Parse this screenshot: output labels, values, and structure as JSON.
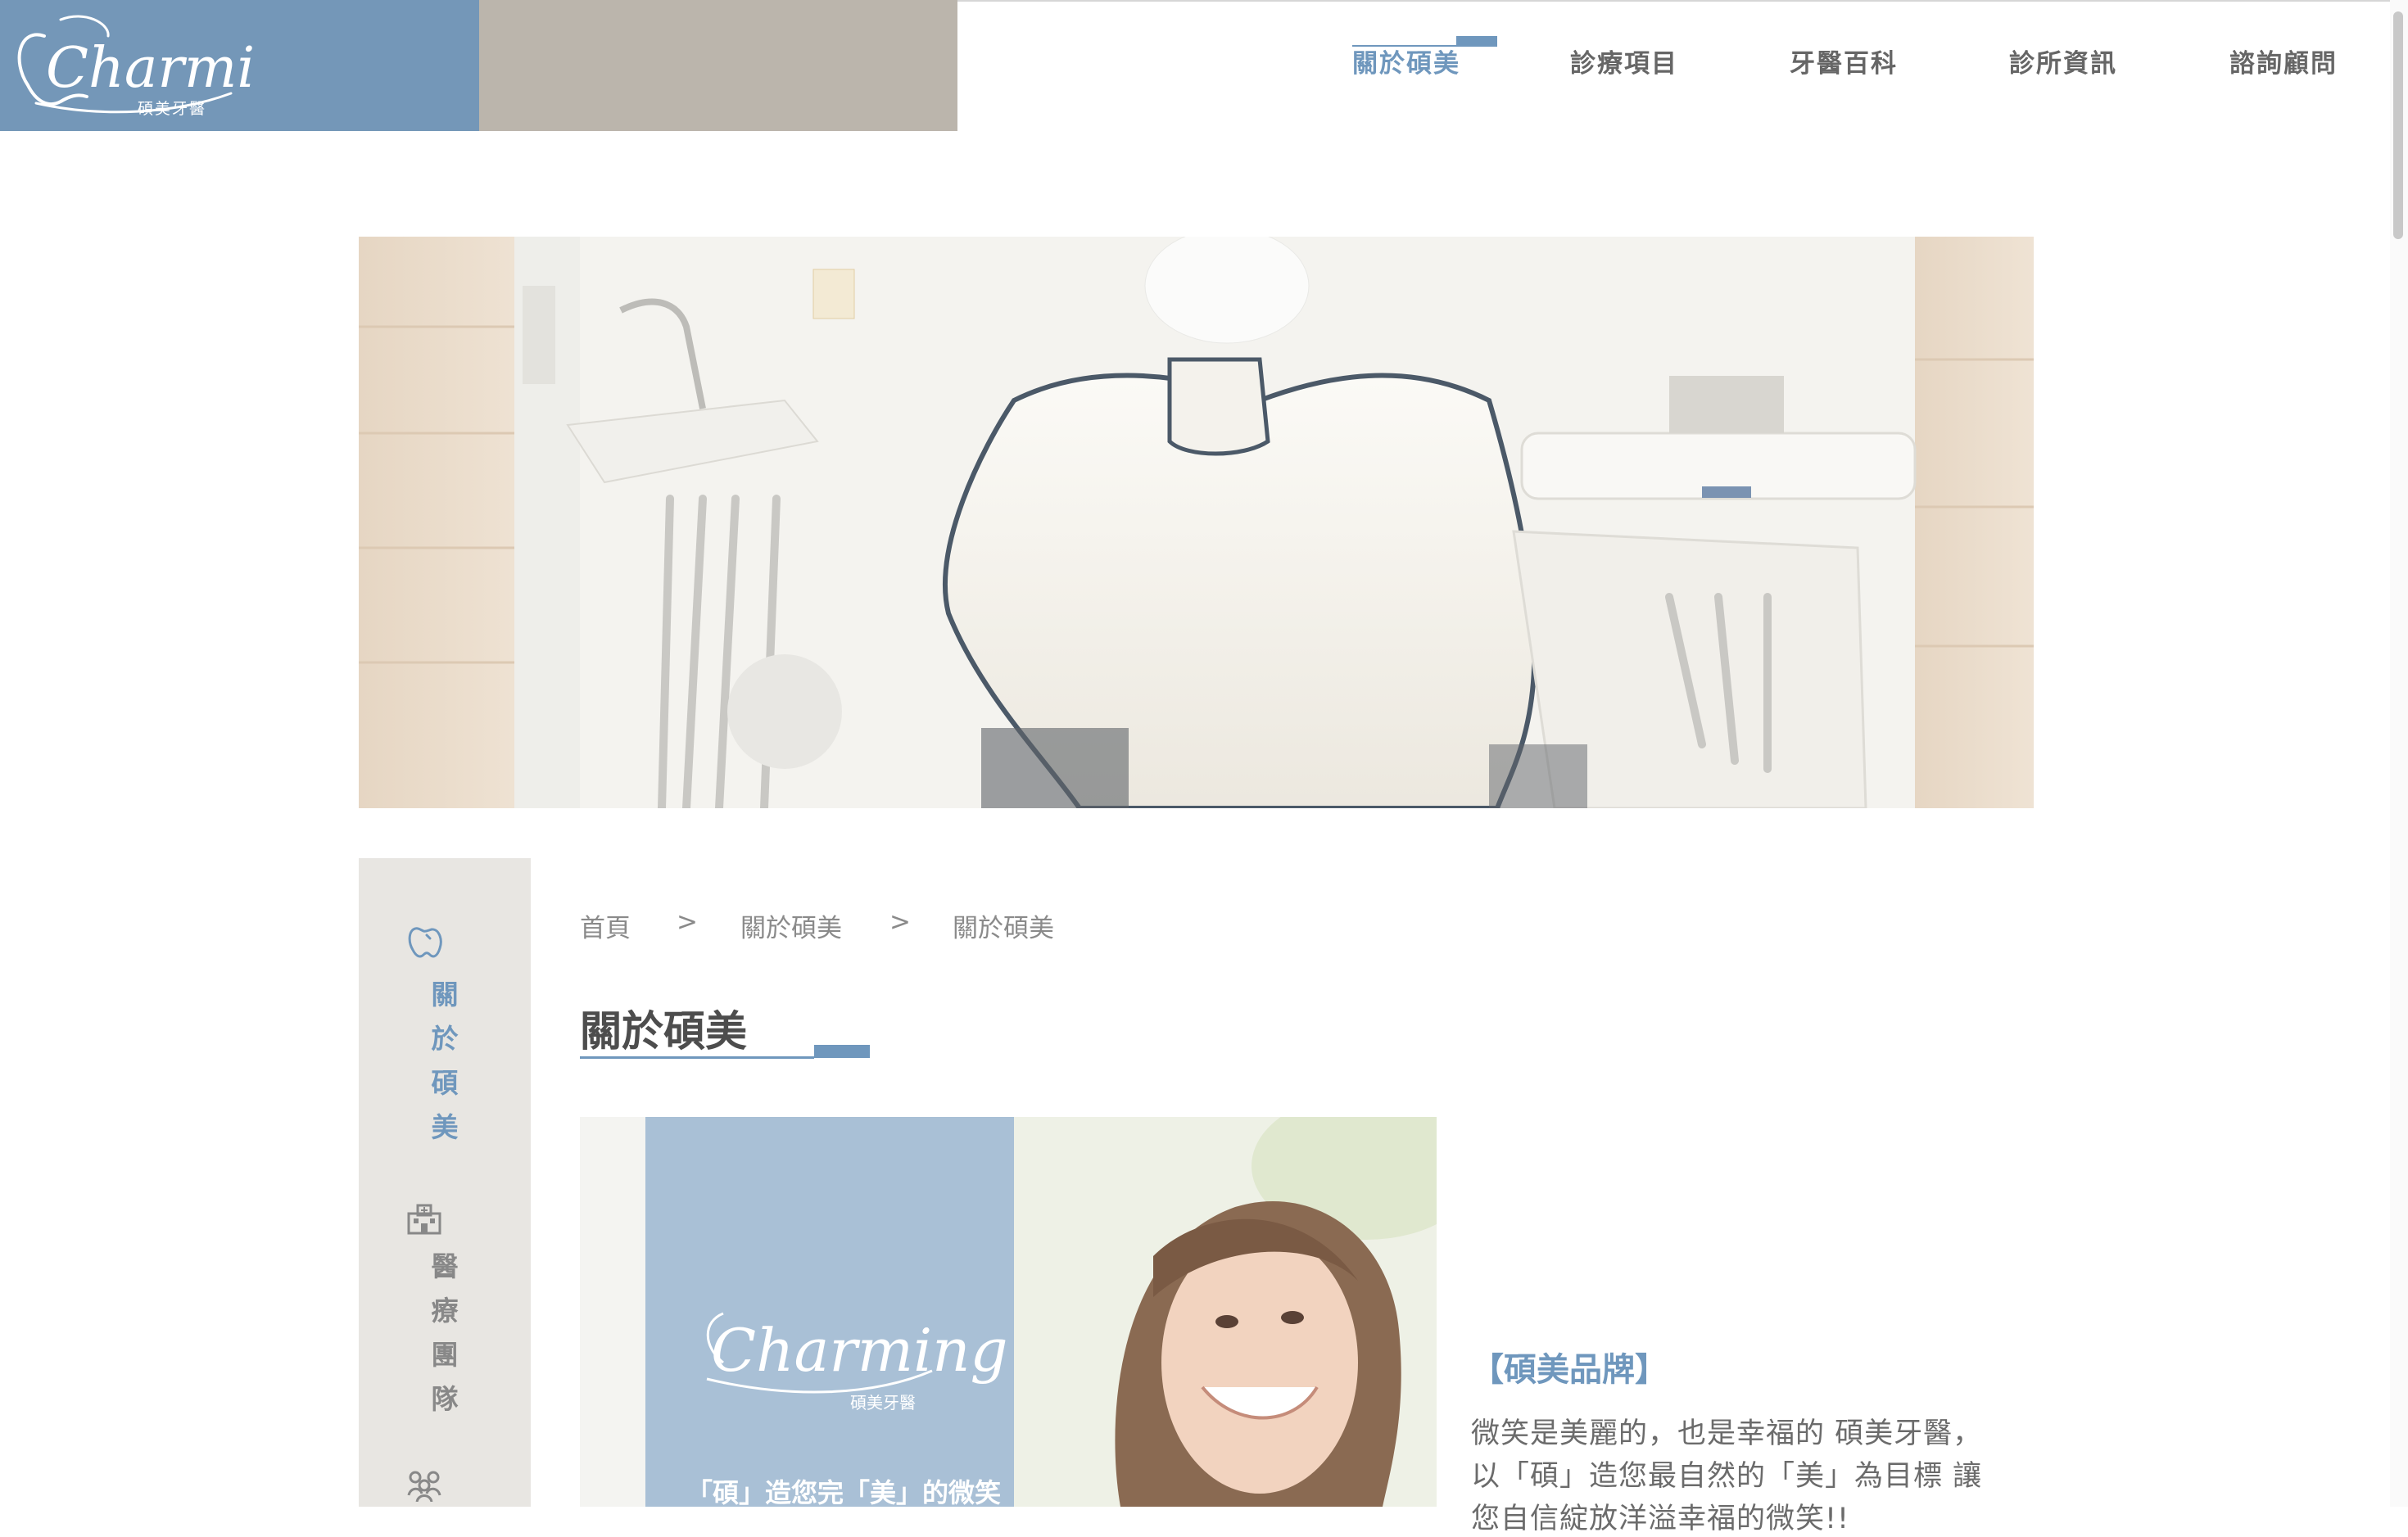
{
  "brand": {
    "logo_script": "Charming",
    "logo_sub": "碩美牙醫"
  },
  "nav": {
    "items": [
      {
        "label": "關於碩美",
        "active": true
      },
      {
        "label": "診療項目",
        "active": false
      },
      {
        "label": "牙醫百科",
        "active": false
      },
      {
        "label": "診所資訊",
        "active": false
      },
      {
        "label": "諮詢顧問",
        "active": false
      }
    ]
  },
  "sidebar": {
    "items": [
      {
        "label": "關於碩美",
        "icon": "tooth-icon",
        "active": true
      },
      {
        "label": "醫療團隊",
        "icon": "building-icon",
        "active": false
      },
      {
        "label": "",
        "icon": "team-icon",
        "active": false
      }
    ]
  },
  "breadcrumb": {
    "items": [
      "首頁",
      "關於碩美",
      "關於碩美"
    ],
    "separator": ">"
  },
  "page_title": "關於碩美",
  "feature": {
    "logo_script": "Charming",
    "logo_sub": "碩美牙醫",
    "slogan": "「碩」造您完「美」的微笑"
  },
  "content": {
    "heading": "【碩美品牌】",
    "lines": [
      "微笑是美麗的，也是幸福的 碩美牙醫，",
      "以「碩」造您最自然的「美」為目標 讓",
      "您自信綻放洋溢幸福的微笑!!"
    ]
  },
  "colors": {
    "accent": "#6f97bd",
    "logo_bg": "#7497b8",
    "tan": "#bbb5ac",
    "sidebar_bg": "#e8e6e2"
  }
}
